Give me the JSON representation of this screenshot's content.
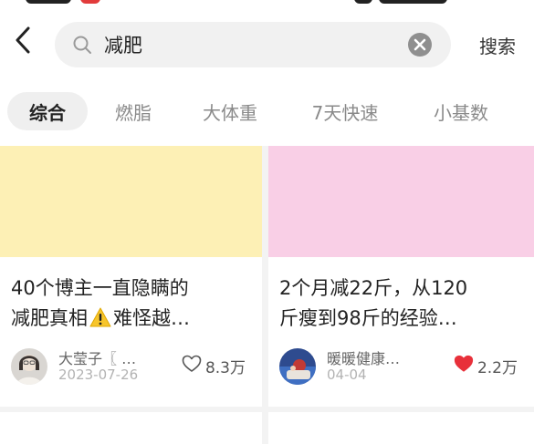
{
  "search": {
    "query": "减肥",
    "submit_label": "搜索"
  },
  "tabs": [
    {
      "label": "综合",
      "active": true
    },
    {
      "label": "燃脂",
      "active": false
    },
    {
      "label": "大体重",
      "active": false
    },
    {
      "label": "7天快速",
      "active": false
    },
    {
      "label": "小基数",
      "active": false
    }
  ],
  "cards": [
    {
      "cover_color": "#fdf0b5",
      "title_line1": "40个博主一直隐瞒的",
      "title_line2_a": "减肥真相",
      "title_line2_b": "难怪越…",
      "author": "大莹子〖 …",
      "date": "2023-07-26",
      "likes": "8.3万",
      "liked": false
    },
    {
      "cover_color": "#f9cfe6",
      "title_line1": "2个月减22斤，从120",
      "title_line2_a": "斤瘦到98斤的经验…",
      "title_line2_b": "",
      "author": "暖暖健康…",
      "date": "04-04",
      "likes": "2.2万",
      "liked": true
    }
  ],
  "colors": {
    "like_active": "#e8303a",
    "tab_active_bg": "#efefef"
  },
  "icons": {
    "back": "chevron-left-icon",
    "search": "search-icon",
    "clear": "clear-icon",
    "warning": "warning-icon",
    "heart_outline": "heart-outline-icon",
    "heart_filled": "heart-filled-icon"
  }
}
